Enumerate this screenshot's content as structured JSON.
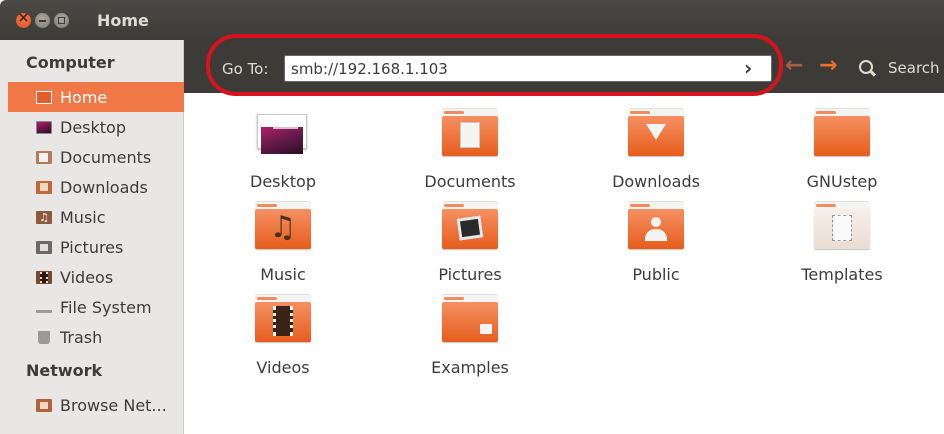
{
  "window": {
    "title": "Home",
    "close_icon": "close-icon",
    "minimize_icon": "minimize-icon",
    "maximize_icon": "maximize-icon"
  },
  "sidebar": {
    "sections": [
      {
        "heading": "Computer",
        "items": [
          {
            "label": "Home",
            "icon": "home-folder-icon",
            "active": true,
            "color": "#e15d2b"
          },
          {
            "label": "Desktop",
            "icon": "desktop-icon",
            "color": "#5b3a5e"
          },
          {
            "label": "Documents",
            "icon": "documents-folder-icon",
            "color": "#b47a5a"
          },
          {
            "label": "Downloads",
            "icon": "downloads-folder-icon",
            "color": "#c0683c"
          },
          {
            "label": "Music",
            "icon": "music-folder-icon",
            "color": "#8a5a3a"
          },
          {
            "label": "Pictures",
            "icon": "pictures-folder-icon",
            "color": "#6a6a6a"
          },
          {
            "label": "Videos",
            "icon": "videos-folder-icon",
            "color": "#7a4a2a"
          },
          {
            "label": "File System",
            "icon": "drive-icon",
            "color": "#bdbdbd"
          },
          {
            "label": "Trash",
            "icon": "trash-icon",
            "color": "#8a8a8a"
          }
        ]
      },
      {
        "heading": "Network",
        "items": [
          {
            "label": "Browse Net...",
            "icon": "network-folder-icon",
            "color": "#b0643a"
          }
        ]
      }
    ]
  },
  "toolbar": {
    "goto_label": "Go To:",
    "location_value": "smb://192.168.1.103",
    "go_icon": "chevron-right-icon",
    "back_icon": "arrow-left-icon",
    "forward_icon": "arrow-right-icon",
    "search_icon": "search-icon",
    "search_label": "Search",
    "highlight_color": "#d8131e"
  },
  "files": [
    {
      "name": "Desktop",
      "icon": "desktop-folder-icon"
    },
    {
      "name": "Documents",
      "icon": "documents-folder-icon"
    },
    {
      "name": "Downloads",
      "icon": "downloads-folder-icon"
    },
    {
      "name": "GNUstep",
      "icon": "folder-icon"
    },
    {
      "name": "Music",
      "icon": "music-folder-icon"
    },
    {
      "name": "Pictures",
      "icon": "pictures-folder-icon"
    },
    {
      "name": "Public",
      "icon": "public-folder-icon"
    },
    {
      "name": "Templates",
      "icon": "templates-folder-icon"
    },
    {
      "name": "Videos",
      "icon": "videos-folder-icon"
    },
    {
      "name": "Examples",
      "icon": "examples-folder-icon"
    }
  ],
  "colors": {
    "accent": "#f07746",
    "titlebar": "#3c3b37",
    "folder_orange": "#e65d1d"
  }
}
